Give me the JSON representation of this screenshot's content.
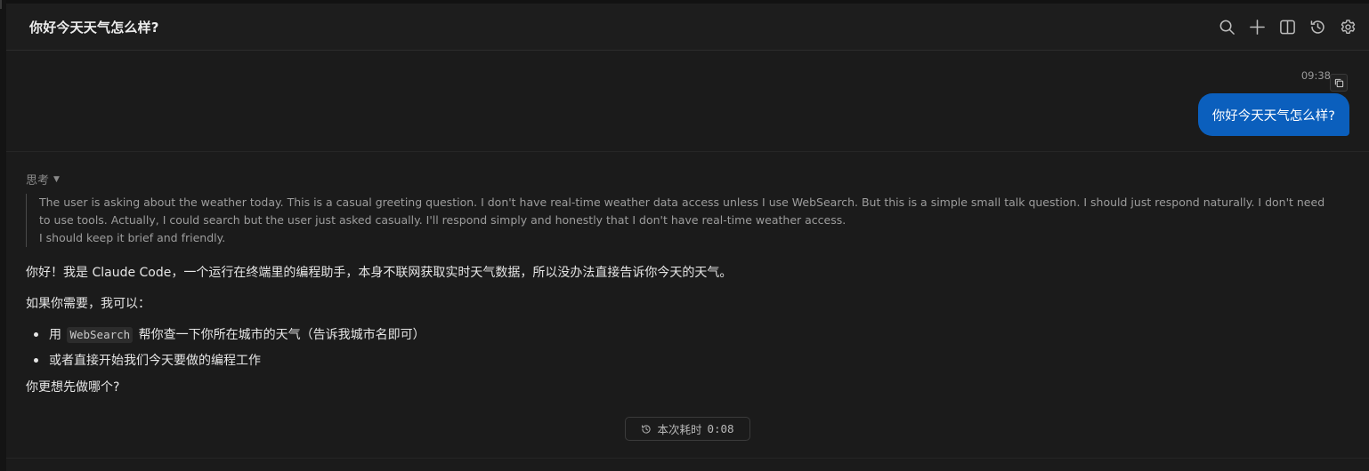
{
  "header": {
    "title": "你好今天天气怎么样?",
    "actions": [
      {
        "name": "search-icon",
        "label": "search"
      },
      {
        "name": "plus-icon",
        "label": "new"
      },
      {
        "name": "split-panel-icon",
        "label": "panel"
      },
      {
        "name": "history-icon",
        "label": "history"
      },
      {
        "name": "gear-icon",
        "label": "settings"
      }
    ]
  },
  "user_message": {
    "time": "09:38",
    "text": "你好今天天气怎么样?"
  },
  "thinking": {
    "label": "思考",
    "caret": "▼",
    "lines": [
      "The user is asking about the weather today. This is a casual greeting question. I don't have real-time weather data access unless I use WebSearch. But this is a simple small talk question. I should just respond naturally. I don't need to use tools. Actually, I could search but the user just asked casually. I'll respond simply and honestly that I don't have real-time weather access.",
      "I should keep it brief and friendly."
    ]
  },
  "reply": {
    "p1": "你好！我是 Claude Code，一个运行在终端里的编程助手，本身不联网获取实时天气数据，所以没办法直接告诉你今天的天气。",
    "p2": "如果你需要，我可以：",
    "bullet1_prefix": "用",
    "bullet1_code": "WebSearch",
    "bullet1_suffix": "帮你查一下你所在城市的天气（告诉我城市名即可）",
    "bullet2": "或者直接开始我们今天要做的编程工作",
    "p3": "你更想先做哪个?"
  },
  "elapsed": {
    "label": "本次耗时",
    "value": "0:08"
  },
  "colors": {
    "accent": "#0b5fbd",
    "background": "#1b1b1b"
  }
}
